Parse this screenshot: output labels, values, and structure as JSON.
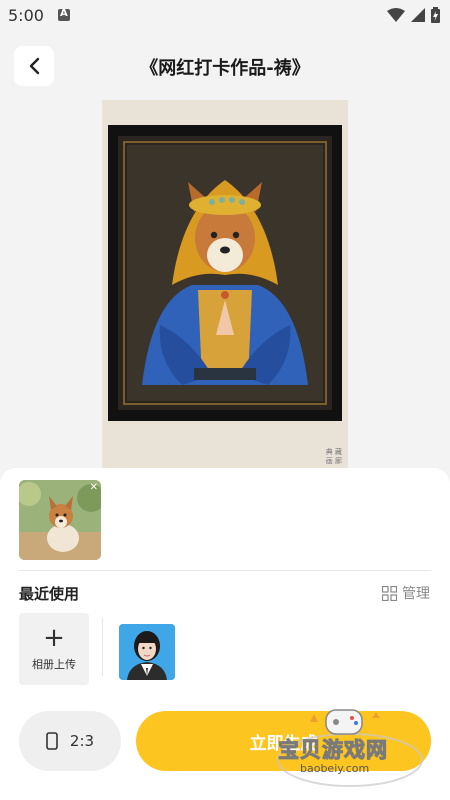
{
  "status_bar": {
    "time": "5:00"
  },
  "header": {
    "title": "《网红打卡作品-祷》"
  },
  "artwork": {
    "stamp": "典 藏\n画 廊"
  },
  "recent": {
    "title": "最近使用",
    "manage_label": "管理",
    "upload_label": "相册上传"
  },
  "actions": {
    "ratio_label": "2:3",
    "generate_label": "立即生成"
  },
  "watermark": {
    "text": "宝贝游戏网",
    "url": "baobeiy.com"
  },
  "colors": {
    "accent": "#fdc51f",
    "panel": "#ffffff",
    "background": "#f3f3f3"
  }
}
